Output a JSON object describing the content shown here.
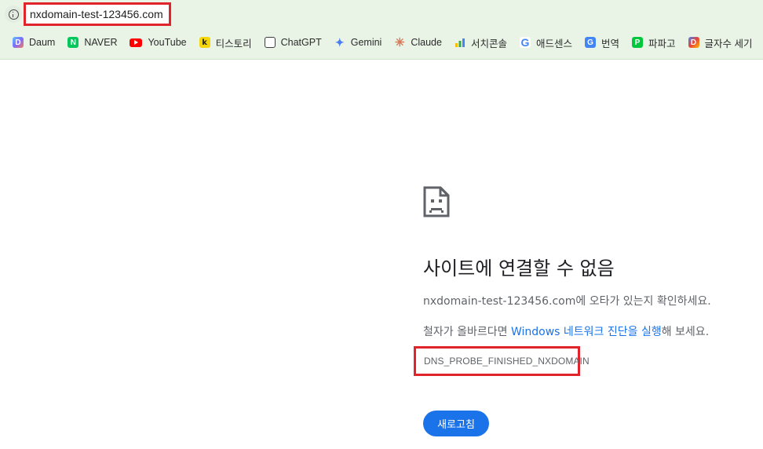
{
  "address_bar": {
    "url": "nxdomain-test-123456.com"
  },
  "bookmarks": [
    {
      "label": "Daum",
      "icon": "daum-icon"
    },
    {
      "label": "NAVER",
      "icon": "naver-icon"
    },
    {
      "label": "YouTube",
      "icon": "youtube-icon"
    },
    {
      "label": "티스토리",
      "icon": "tistory-icon"
    },
    {
      "label": "ChatGPT",
      "icon": "chatgpt-icon"
    },
    {
      "label": "Gemini",
      "icon": "gemini-icon"
    },
    {
      "label": "Claude",
      "icon": "claude-icon"
    },
    {
      "label": "서치콘솔",
      "icon": "search-console-icon"
    },
    {
      "label": "애드센스",
      "icon": "google-icon"
    },
    {
      "label": "번역",
      "icon": "translate-icon"
    },
    {
      "label": "파파고",
      "icon": "papago-icon"
    },
    {
      "label": "글자수 세기",
      "icon": "docs-icon"
    }
  ],
  "error": {
    "title": "사이트에 연결할 수 없음",
    "line1": "nxdomain-test-123456.com에 오타가 있는지 확인하세요.",
    "line2_prefix": "철자가 올바르다면 ",
    "line2_link": "Windows 네트워크 진단을 실행",
    "line2_suffix": "해 보세요.",
    "code": "DNS_PROBE_FINISHED_NXDOMAIN",
    "reload_label": "새로고침"
  },
  "colors": {
    "chrome_bg": "#e9f4e6",
    "highlight_red": "#e1232c",
    "link_blue": "#1a73e8",
    "button_blue": "#1a73e8"
  }
}
